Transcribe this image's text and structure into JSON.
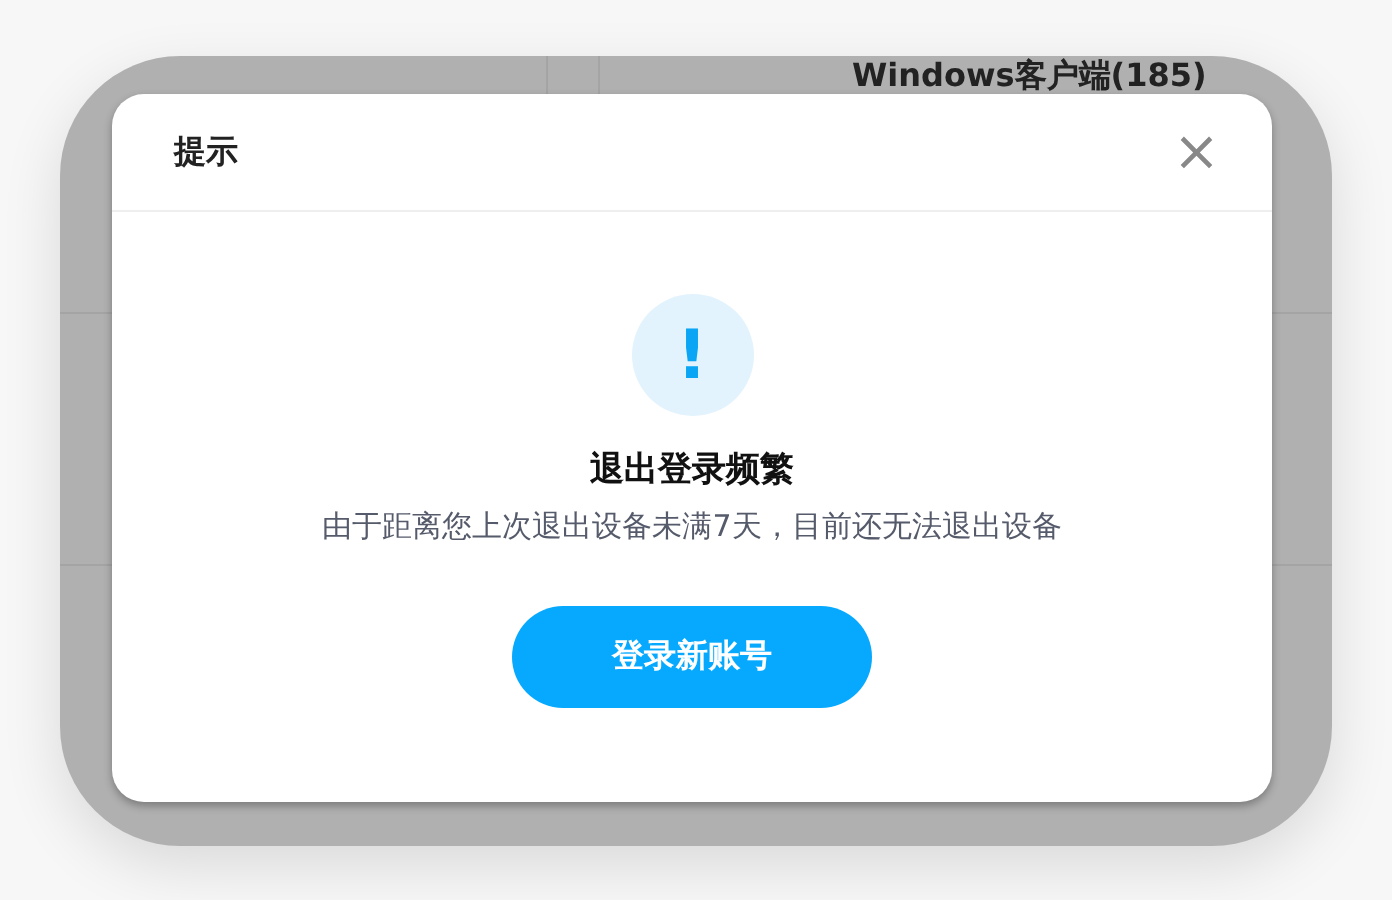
{
  "background": {
    "header_text": "Windows客户端(185)"
  },
  "dialog": {
    "title": "提示",
    "close": "×",
    "icon": "!",
    "heading": "退出登录频繁",
    "message": "由于距离您上次退出设备未满7天，目前还无法退出设备",
    "button": "登录新账号"
  }
}
